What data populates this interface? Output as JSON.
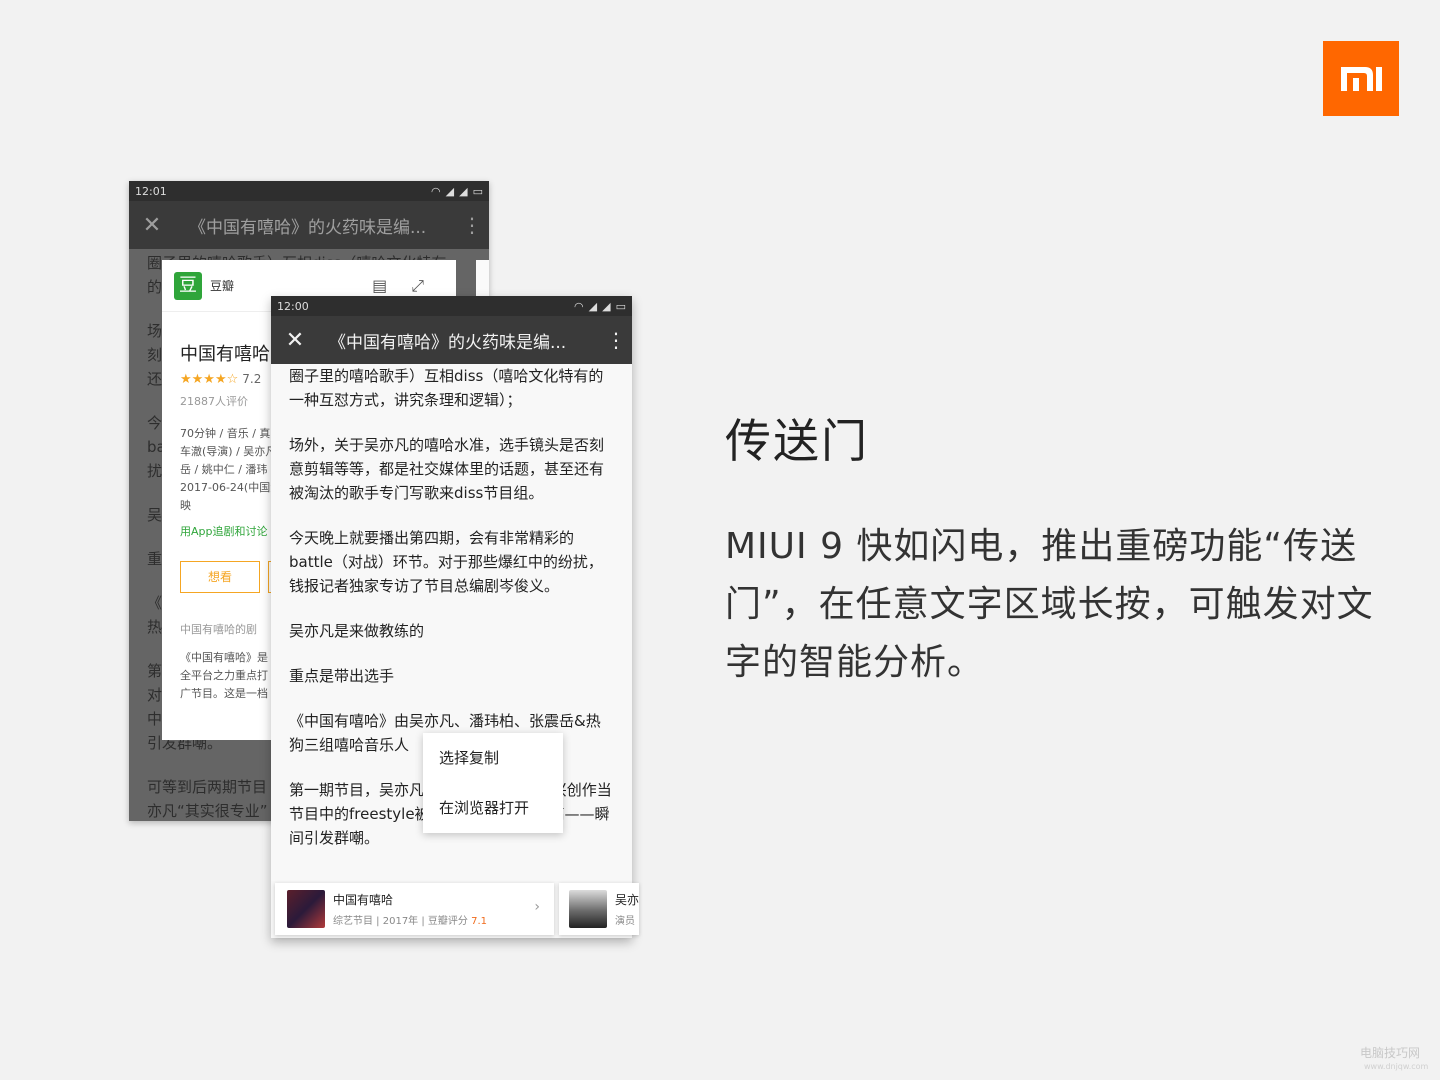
{
  "brand": {
    "logo_text": "mi",
    "color": "#ff6700"
  },
  "slide": {
    "title": "传送门",
    "description": "MIUI 9 快如闪电，推出重磅功能“传送门”，在任意文字区域长按，可触发对文字的智能分析。"
  },
  "back_phone": {
    "time": "12:01",
    "page_title": "《中国有嘻哈》的火药味是编...",
    "article_lines": [
      "圈子里的嘻哈歌手）互相diss（嘻哈文化特有",
      "的",
      "场",
      "刻",
      "还",
      "今",
      "ba",
      "扰",
      "吴",
      "重",
      "《",
      "热",
      "第",
      "对",
      "中",
      "引发群嘲。",
      "可等到后两期节目",
      "亦凡“其实很专业”"
    ],
    "douban": {
      "source": "豆瓣",
      "movie_title": "中国有嘻哈",
      "stars": "★★★★☆",
      "score": "7.2",
      "votes": "21887人评价",
      "info_lines": [
        "70分钟 / 音乐 / 真",
        "车澈(导演) / 吴亦凡",
        "岳 / 姚中仁 / 潘玮",
        "2017-06-24(中国大",
        "映"
      ],
      "app_link": "用App追剧和讨论",
      "want_button": "想看",
      "section_title": "中国有嘻哈的剧",
      "summary_lines": [
        "《中国有嘻哈》是",
        "全平台之力重点打",
        "广节目。这是一档"
      ]
    }
  },
  "front_phone": {
    "time": "12:00",
    "page_title": "《中国有嘻哈》的火药味是编...",
    "paragraphs": [
      "圈子里的嘻哈歌手）互相diss（嘻哈文化特有的一种互怼方式，讲究条理和逻辑）；",
      "场外，关于吴亦凡的嘻哈水准，选手镜头是否刻意剪辑等等，都是社交媒体里的话题，甚至还有被淘汰的歌手专门写歌来diss节目组。",
      "今天晚上就要播出第四期，会有非常精彩的battle（对战）环节。对于那些爆红中的纷扰，钱报记者独家专访了节目总编剧岑俊义。",
      "吴亦凡是来做教练的",
      "重点是带出选手",
      "《中国有嘻哈》由吴亦凡、潘玮柏、张震岳&热狗三组嘻哈音乐人",
      "第一期节目，吴亦凡常要求对方来段“即兴创作当节目中的freestyle被翻出，水平看实不高——瞬间引发群嘲。"
    ],
    "context_menu": [
      "选择复制",
      "在浏览器打开"
    ],
    "cards": [
      {
        "name": "中国有嘻哈",
        "meta_prefix": "综艺节目 | 2017年 | 豆瓣评分 ",
        "score": "7.1",
        "arrow": "›"
      },
      {
        "name": "吴亦",
        "meta": "演员"
      }
    ]
  },
  "watermark": {
    "line1": "电脑技巧网",
    "line2": "www.dnjqw.com"
  }
}
